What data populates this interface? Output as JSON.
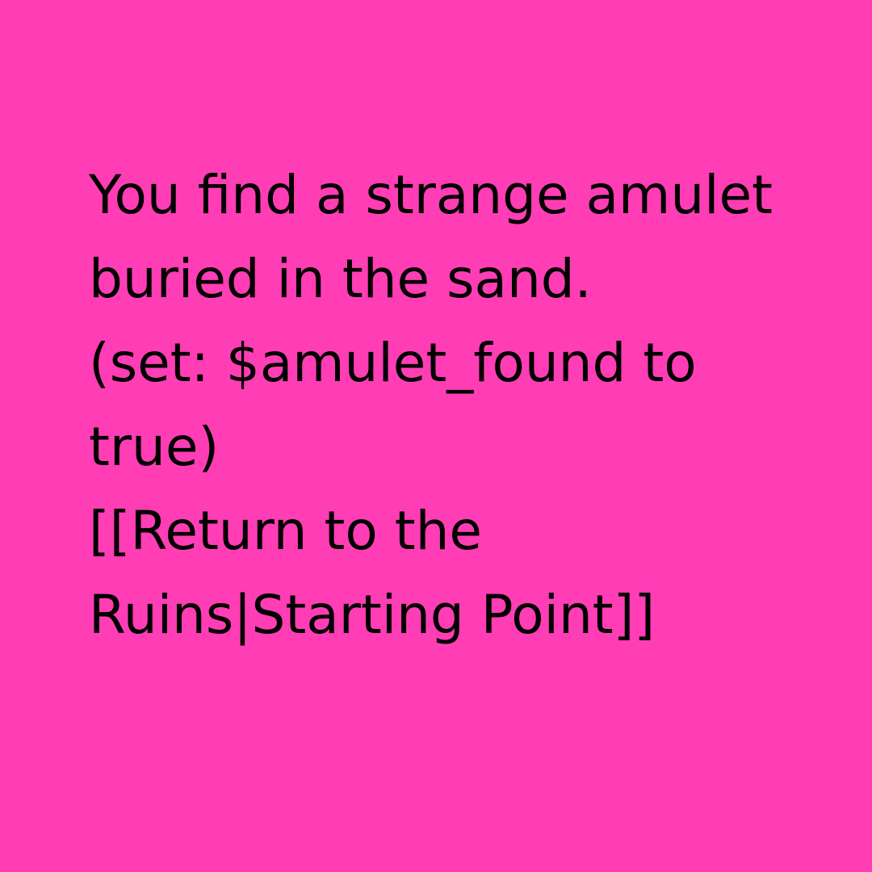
{
  "background_color": "#FF3DB5",
  "text_color": "#000000",
  "passage": {
    "lines": [
      "You find a strange amulet",
      "buried in the sand.",
      "(set: $amulet_found to",
      "true)",
      "[[Return to the",
      "Ruins|Starting Point]]"
    ]
  }
}
